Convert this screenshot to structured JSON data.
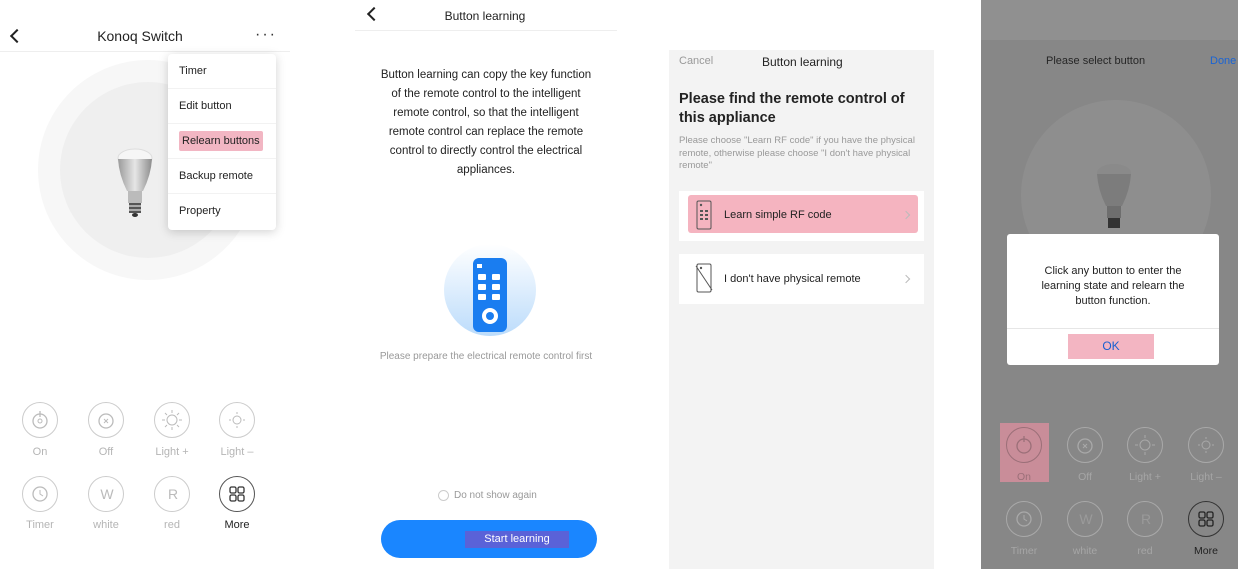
{
  "panel1": {
    "header": {
      "title": "Konoq Switch",
      "more": "···"
    },
    "menu": [
      "Timer",
      "Edit button",
      "Relearn buttons",
      "Backup remote",
      "Property"
    ],
    "controls": [
      {
        "label": "On",
        "icon": "power-icon"
      },
      {
        "label": "Off",
        "icon": "power-off-icon"
      },
      {
        "label": "Light +",
        "icon": "sun-plus-icon"
      },
      {
        "label": "Light –",
        "icon": "sun-minus-icon"
      },
      {
        "label": "Timer",
        "icon": "clock-icon"
      },
      {
        "label": "white",
        "letter": "W"
      },
      {
        "label": "red",
        "letter": "R"
      },
      {
        "label": "More",
        "icon": "grid-icon"
      }
    ]
  },
  "panel2": {
    "header": {
      "title": "Button learning"
    },
    "description": "Button learning can copy the key function of the remote control to the intelligent remote control, so that the intelligent remote control can replace the remote control to directly control the electrical appliances.",
    "prepare": "Please prepare the electrical remote control first",
    "do_not_show": "Do not show again",
    "start_button": "Start learning"
  },
  "panel3": {
    "cancel": "Cancel",
    "title": "Button learning",
    "heading": "Please find the remote control of this appliance",
    "subtext": "Please choose \"Learn RF code\" if you have the physical remote, otherwise please choose \"I don't have physical remote\"",
    "options": [
      "Learn simple RF code",
      "I don't have physical remote"
    ]
  },
  "panel4": {
    "title": "Please select button",
    "done": "Done",
    "dialog": {
      "message": "Click any button to enter the learning state and relearn the button function.",
      "ok": "OK"
    },
    "controls": [
      {
        "label": "On"
      },
      {
        "label": "Off"
      },
      {
        "label": "Light +"
      },
      {
        "label": "Light –"
      },
      {
        "label": "Timer"
      },
      {
        "label": "white",
        "letter": "W"
      },
      {
        "label": "red",
        "letter": "R"
      },
      {
        "label": "More"
      }
    ]
  },
  "colors": {
    "highlight_pink": "#f2b6c3",
    "primary_blue": "#1a86ff",
    "overlay_gray": "#878787"
  }
}
